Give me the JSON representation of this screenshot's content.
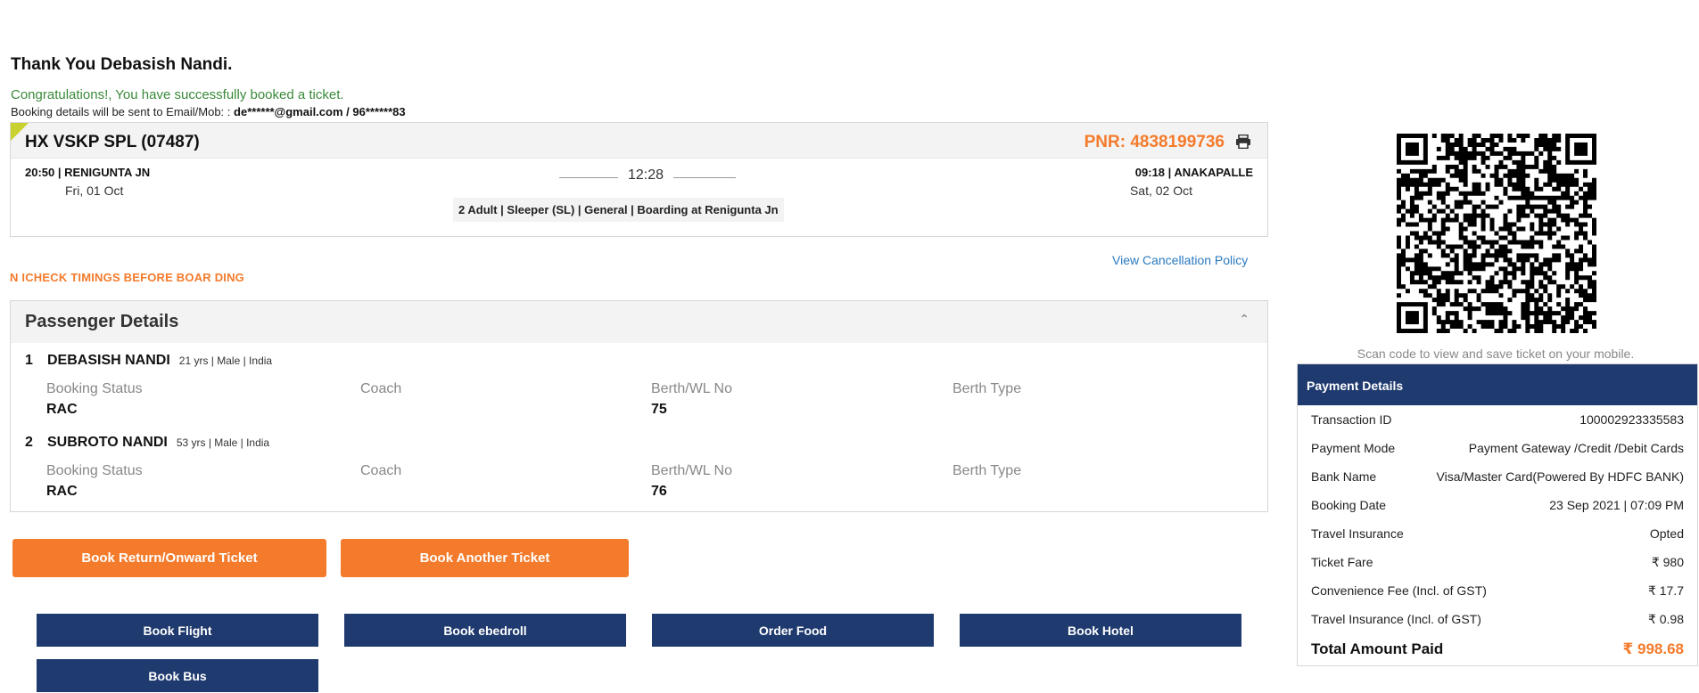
{
  "header": {
    "thanks": "Thank You Debasish Nandi.",
    "congrats": "Congratulations!, You have successfully booked a ticket.",
    "sent_prefix": "Booking details will be sent to Email/Mob: :",
    "sent_contact": "de******@gmail.com / 96******83"
  },
  "train": {
    "name": "HX VSKP SPL (07487)",
    "pnr": "PNR: 4838199736",
    "departure_time": "20:50 | RENIGUNTA JN",
    "departure_date": "Fri, 01 Oct",
    "duration": "12:28",
    "arrival_time": "09:18 | ANAKAPALLE",
    "arrival_date": "Sat, 02 Oct",
    "journey_info": "2 Adult | Sleeper (SL) | General | Boarding at Renigunta Jn",
    "corner_color": "#c9d12f"
  },
  "links": {
    "cancellation": "View Cancellation Policy"
  },
  "notice": "N ICHECK TIMINGS BEFORE BOAR DING",
  "passengers": {
    "title": "Passenger Details",
    "labels": {
      "booking_status": "Booking Status",
      "coach": "Coach",
      "berth_no": "Berth/WL No",
      "berth_type": "Berth Type"
    },
    "list": [
      {
        "num": "1",
        "name": "DEBASISH NANDI",
        "meta": "21 yrs | Male | India",
        "status": "RAC",
        "coach": "",
        "berth_no": "75",
        "berth_type": ""
      },
      {
        "num": "2",
        "name": "SUBROTO NANDI",
        "meta": "53 yrs | Male | India",
        "status": "RAC",
        "coach": "",
        "berth_no": "76",
        "berth_type": ""
      }
    ]
  },
  "buttons": {
    "book_return": "Book Return/Onward Ticket",
    "book_another": "Book Another Ticket",
    "book_flight": "Book Flight",
    "book_ebedroll": "Book ebedroll",
    "order_food": "Order Food",
    "book_hotel": "Book Hotel",
    "book_bus": "Book Bus"
  },
  "qr": {
    "caption": "Scan code to view and save ticket on your mobile."
  },
  "payment": {
    "title": "Payment Details",
    "rows": [
      {
        "label": "Transaction ID",
        "value": "100002923335583"
      },
      {
        "label": "Payment Mode",
        "value": "Payment Gateway /Credit /Debit Cards"
      },
      {
        "label": "Bank Name",
        "value": "Visa/Master Card(Powered By HDFC BANK)"
      },
      {
        "label": "Booking Date",
        "value": "23 Sep 2021 | 07:09 PM"
      },
      {
        "label": "Travel Insurance",
        "value": "Opted"
      },
      {
        "label": "Ticket Fare",
        "value": "₹ 980"
      },
      {
        "label": "Convenience Fee (Incl. of GST)",
        "value": "₹ 17.7"
      },
      {
        "label": "Travel Insurance (Incl. of GST)",
        "value": "₹ 0.98"
      }
    ],
    "total_label": "Total Amount Paid",
    "total_value": "₹ 998.68"
  },
  "colors": {
    "accent_orange": "#f47b2c",
    "navy": "#1f3a6e",
    "success_green": "#3a8a3a",
    "link_blue": "#2a7abf"
  }
}
